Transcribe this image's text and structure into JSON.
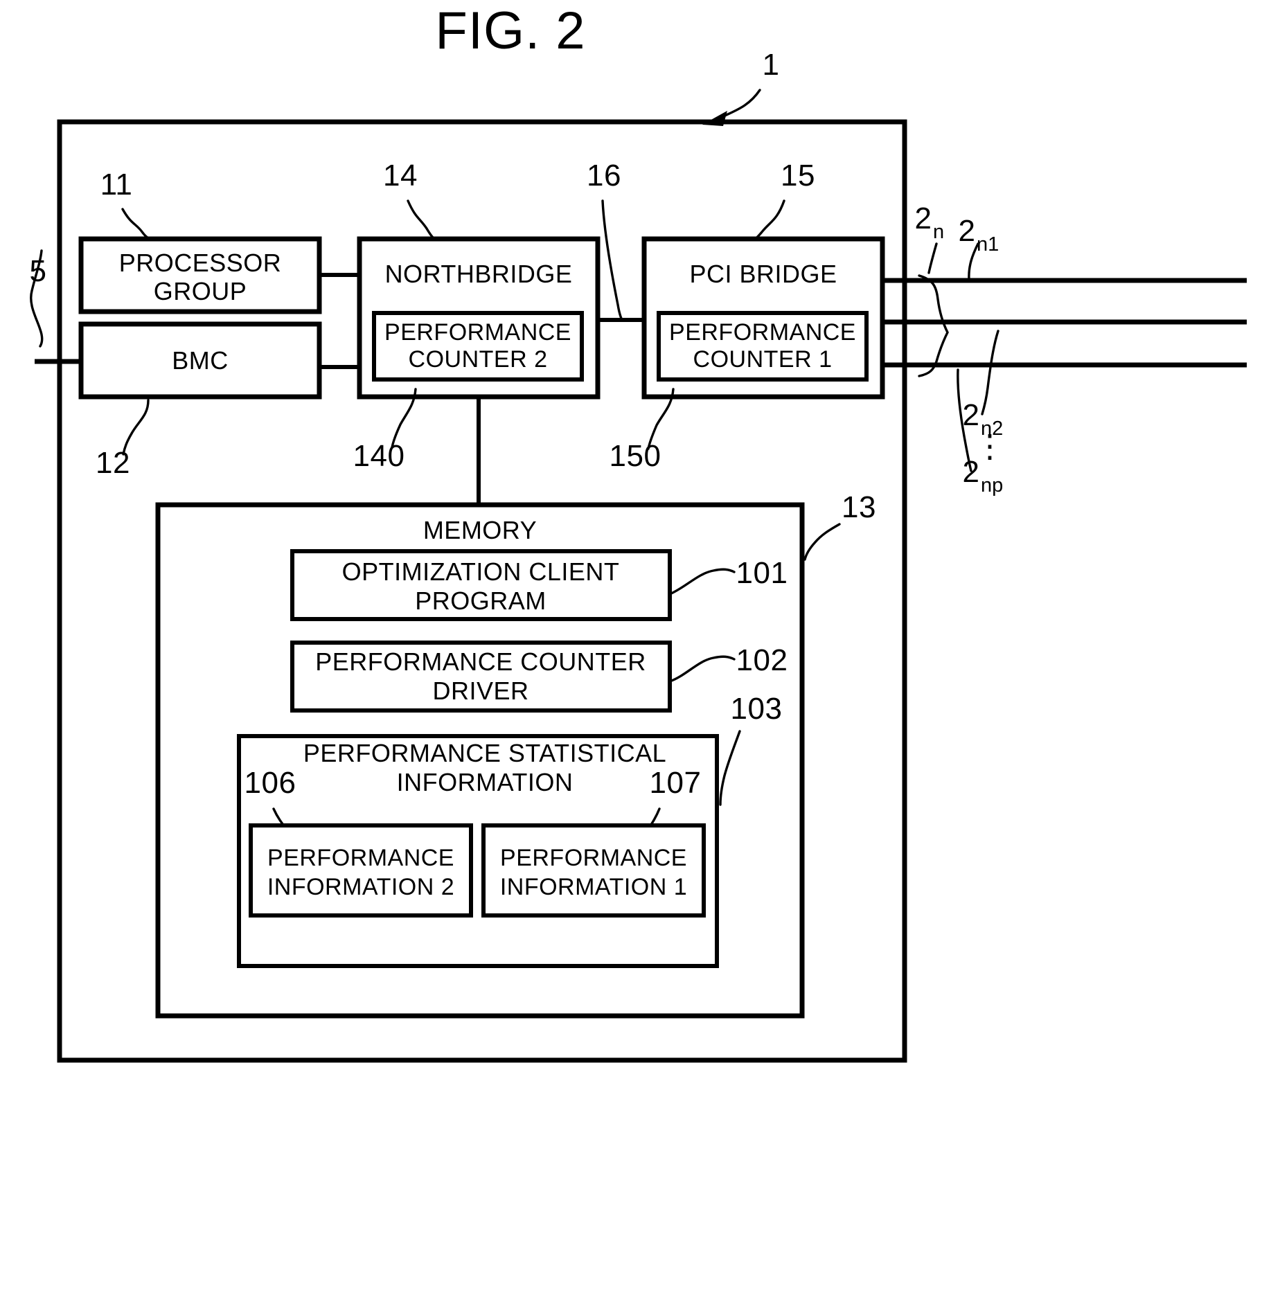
{
  "figure": {
    "title": "FIG. 2",
    "system_ref": "1",
    "external_bus_ref": "5"
  },
  "blocks": {
    "processor_group": {
      "label": "PROCESSOR GROUP",
      "line1": "PROCESSOR",
      "line2": "GROUP",
      "ref": "11"
    },
    "bmc": {
      "label": "BMC",
      "ref": "12"
    },
    "northbridge": {
      "label": "NORTHBRIDGE",
      "ref": "14"
    },
    "performance_counter_2": {
      "line1": "PERFORMANCE",
      "line2": "COUNTER 2",
      "ref": "140"
    },
    "pci_bridge": {
      "label": "PCI BRIDGE",
      "ref": "15"
    },
    "performance_counter_1": {
      "line1": "PERFORMANCE",
      "line2": "COUNTER 1",
      "ref": "150"
    },
    "interconnect": {
      "ref": "16"
    },
    "memory": {
      "label": "MEMORY",
      "ref": "13"
    },
    "optimization_client_program": {
      "line1": "OPTIMIZATION CLIENT",
      "line2": "PROGRAM",
      "ref": "101"
    },
    "performance_counter_driver": {
      "line1": "PERFORMANCE COUNTER",
      "line2": "DRIVER",
      "ref": "102"
    },
    "performance_statistical_information": {
      "line1": "PERFORMANCE STATISTICAL",
      "line2": "INFORMATION",
      "ref": "103"
    },
    "performance_information_2": {
      "line1": "PERFORMANCE",
      "line2": "INFORMATION 2",
      "ref": "106"
    },
    "performance_information_1": {
      "line1": "PERFORMANCE",
      "line2": "INFORMATION 1",
      "ref": "107"
    }
  },
  "io_bus_labels": {
    "group": {
      "base": "2",
      "sub": "n"
    },
    "line1": {
      "base": "2",
      "sub": "n1"
    },
    "line2": {
      "base": "2",
      "sub": "n2"
    },
    "line_p": {
      "base": "2",
      "sub": "np"
    },
    "ellipsis": "⋮"
  }
}
